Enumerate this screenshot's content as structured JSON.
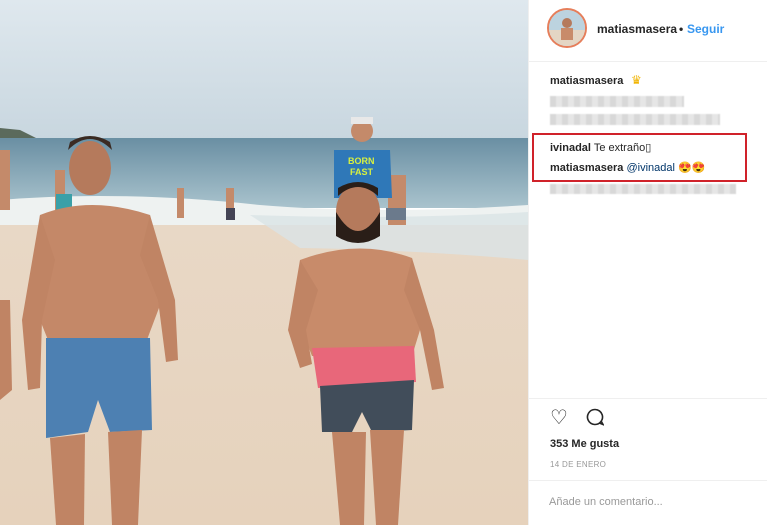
{
  "post": {
    "username": "matiasmasera",
    "separator": "•",
    "follow_label": "Seguir",
    "caption_user": "matiasmasera",
    "caption_emoji": "♛",
    "comments": [
      {
        "user": "ivinadal",
        "text": "Te extraño",
        "trailing": "▯"
      },
      {
        "user": "matiasmasera",
        "mention": "@ivinadal",
        "emoji": "😍😍"
      }
    ],
    "likes": "353 Me gusta",
    "date": "14 DE ENERO",
    "comment_placeholder": "Añade un comentario..."
  },
  "photo": {
    "shirt_text_line1": "BORN",
    "shirt_text_line2": "FAST"
  },
  "icons": [
    "heart-icon",
    "comment-icon"
  ],
  "colors": {
    "accent": "#3897f0",
    "highlight": "#d0222a",
    "text": "#262626"
  }
}
